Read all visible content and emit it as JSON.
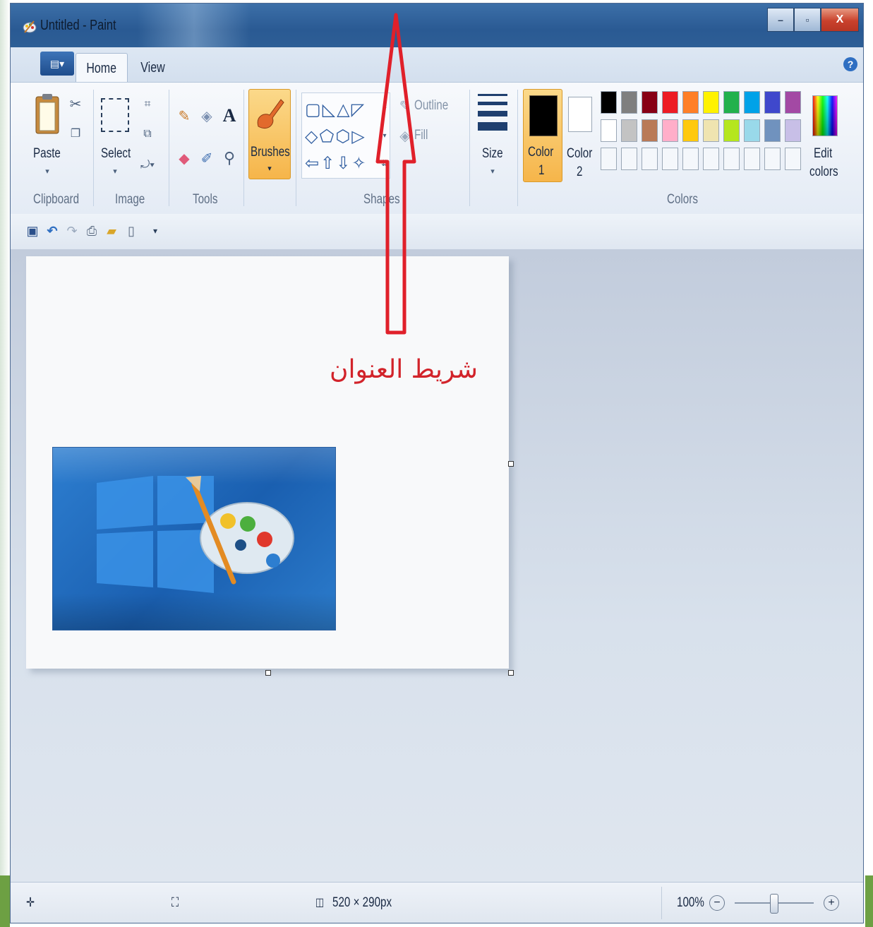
{
  "window": {
    "title": "Untitled - Paint",
    "controls": {
      "minimize": "–",
      "maximize": "▫",
      "close": "X"
    }
  },
  "tabs": {
    "menu_glyph": "▤▾",
    "home": "Home",
    "view": "View",
    "help": "?"
  },
  "ribbon": {
    "clipboard": {
      "paste": "Paste",
      "group": "Clipboard"
    },
    "image": {
      "select": "Select",
      "group": "Image"
    },
    "tools": {
      "group": "Tools",
      "text_tool": "A"
    },
    "brushes": "Brushes",
    "shapes": {
      "outline": "Outline",
      "fill": "Fill",
      "group": "Shapes"
    },
    "size": "Size",
    "color1": {
      "line1": "Color",
      "line2": "1"
    },
    "color2": {
      "line1": "Color",
      "line2": "2"
    },
    "colors_group": "Colors",
    "edit_colors": {
      "line1": "Edit",
      "line2": "colors"
    },
    "palette_row1": [
      "#000000",
      "#7f7f7f",
      "#880015",
      "#ed1c24",
      "#ff7f27",
      "#fff200",
      "#22b14c",
      "#00a2e8",
      "#3f48cc",
      "#a349a4"
    ],
    "palette_row2": [
      "#ffffff",
      "#c3c3c3",
      "#b97a57",
      "#ffaec9",
      "#ffc90e",
      "#efe4b0",
      "#b5e61d",
      "#99d9ea",
      "#7092be",
      "#c8bfe7"
    ],
    "primary_color": "#000000",
    "secondary_color": "#ffffff"
  },
  "canvas": {
    "annotation": "شريط العنوان",
    "arrow_color": "#e0202a"
  },
  "statusbar": {
    "dimensions": "520 × 290px",
    "zoom": "100%"
  }
}
